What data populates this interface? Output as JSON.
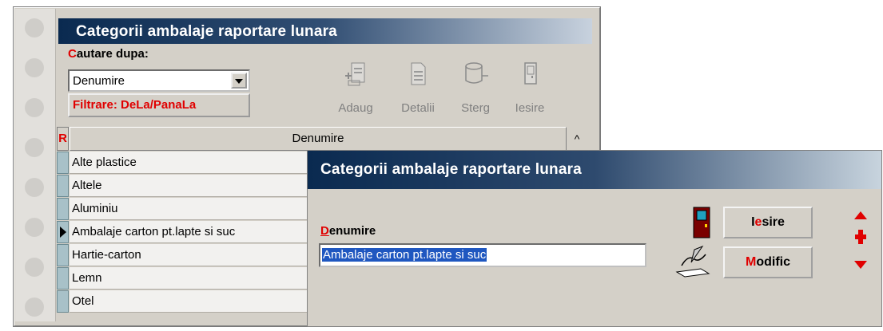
{
  "list_window": {
    "title": "Categorii ambalaje raportare lunara",
    "search_label_first": "C",
    "search_label_rest": "autare dupa:",
    "search_combo_value": "Denumire",
    "filter_label": "Filtrare: DeLa/PanaLa",
    "toolbar": {
      "add_label": "Adaug",
      "details_label": "Detalii",
      "delete_label": "Sterg",
      "exit_label": "Iesire"
    },
    "grid": {
      "indicator_header": "R",
      "column_header": "Denumire",
      "scroll_up": "^",
      "rows": [
        "Alte plastice",
        "Altele",
        "Aluminiu",
        "Ambalaje carton pt.lapte si suc",
        "Hartie-carton",
        "Lemn",
        "Otel"
      ]
    }
  },
  "edit_dialog": {
    "title": "Categorii ambalaje raportare lunara",
    "field_label_first": "D",
    "field_label_rest": "enumire",
    "field_value": "Ambalaje carton pt.lapte si suc",
    "exit_button_a": "I",
    "exit_button_hl": "e",
    "exit_button_b": "sire",
    "modify_button_hl": "M",
    "modify_button_rest": "odific"
  },
  "colors": {
    "accent_red": "#e00000",
    "title_gradient_dark": "#0a2a50",
    "selection_blue": "#1f57c0"
  }
}
